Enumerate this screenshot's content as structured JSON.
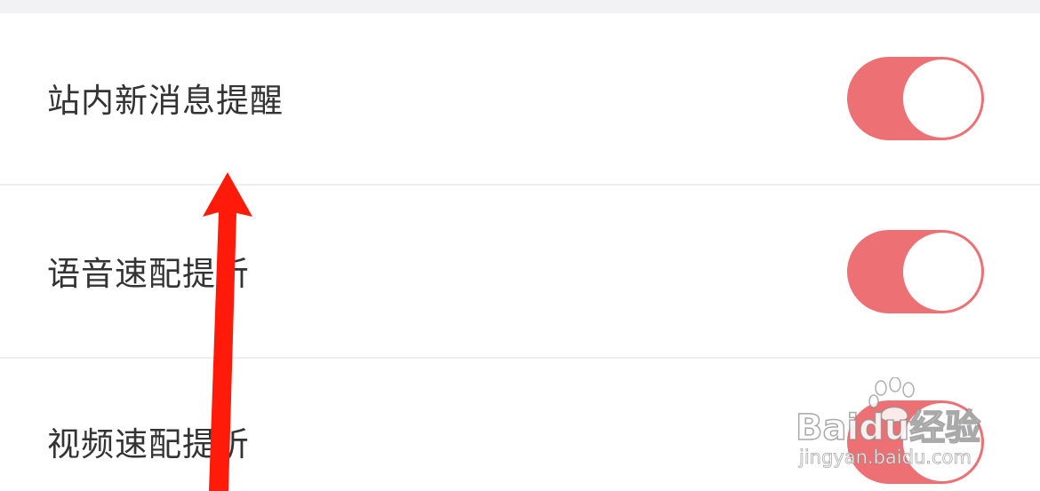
{
  "settings": {
    "items": [
      {
        "label": "站内新消息提醒",
        "enabled": true
      },
      {
        "label": "语音速配提听",
        "enabled": true
      },
      {
        "label": "视频速配提听",
        "enabled": true
      }
    ]
  },
  "theme": {
    "toggle_on_color": "#ec7074",
    "annotation_arrow_color": "#ff1a0a"
  },
  "watermark": {
    "brand": "Baidu经验",
    "url": "jingyan.baidu.com"
  }
}
